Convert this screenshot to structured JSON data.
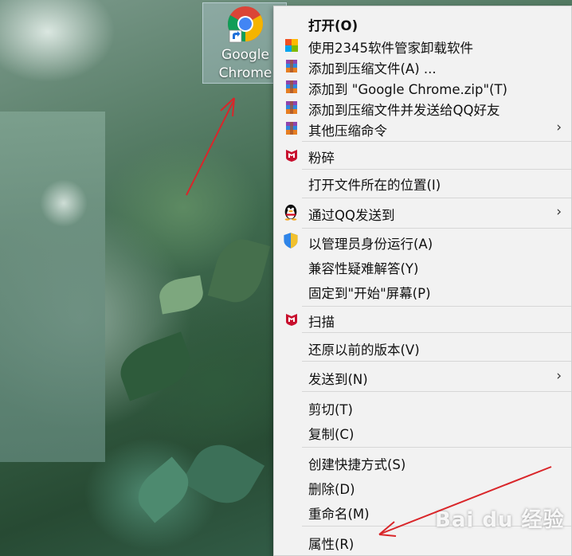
{
  "desktop": {
    "icon_label_line1": "Google",
    "icon_label_line2": "Chrome"
  },
  "menu": {
    "items": [
      {
        "label": "打开(O)",
        "icon": "none",
        "bold": true
      },
      {
        "label": "使用2345软件管家卸载软件",
        "icon": "2345-app-icon"
      },
      {
        "label": "添加到压缩文件(A) ...",
        "icon": "winrar-icon"
      },
      {
        "label": "添加到 \"Google Chrome.zip\"(T)",
        "icon": "winrar-icon"
      },
      {
        "label": "添加到压缩文件并发送给QQ好友",
        "icon": "winrar-icon"
      },
      {
        "label": "其他压缩命令",
        "icon": "winrar-icon",
        "submenu": true
      },
      {
        "label": "粉碎",
        "icon": "mcafee-icon"
      },
      {
        "label": "打开文件所在的位置(I)",
        "icon": "none"
      },
      {
        "label": "通过QQ发送到",
        "icon": "qq-penguin-icon",
        "submenu": true
      },
      {
        "label": "以管理员身份运行(A)",
        "icon": "uac-shield-icon"
      },
      {
        "label": "兼容性疑难解答(Y)",
        "icon": "none"
      },
      {
        "label": "固定到\"开始\"屏幕(P)",
        "icon": "none"
      },
      {
        "label": "扫描",
        "icon": "mcafee-icon"
      },
      {
        "label": "还原以前的版本(V)",
        "icon": "none"
      },
      {
        "label": "发送到(N)",
        "icon": "none",
        "submenu": true
      },
      {
        "label": "剪切(T)",
        "icon": "none"
      },
      {
        "label": "复制(C)",
        "icon": "none"
      },
      {
        "label": "创建快捷方式(S)",
        "icon": "none"
      },
      {
        "label": "删除(D)",
        "icon": "none"
      },
      {
        "label": "重命名(M)",
        "icon": "none"
      },
      {
        "label": "属性(R)",
        "icon": "none"
      }
    ],
    "submenu_glyph": "›"
  },
  "watermark": {
    "text": "Bai du 经验"
  },
  "colors": {
    "annotation_arrow": "#d9262a",
    "menu_bg": "#f2f2f2",
    "mcafee_red": "#c8102e"
  }
}
